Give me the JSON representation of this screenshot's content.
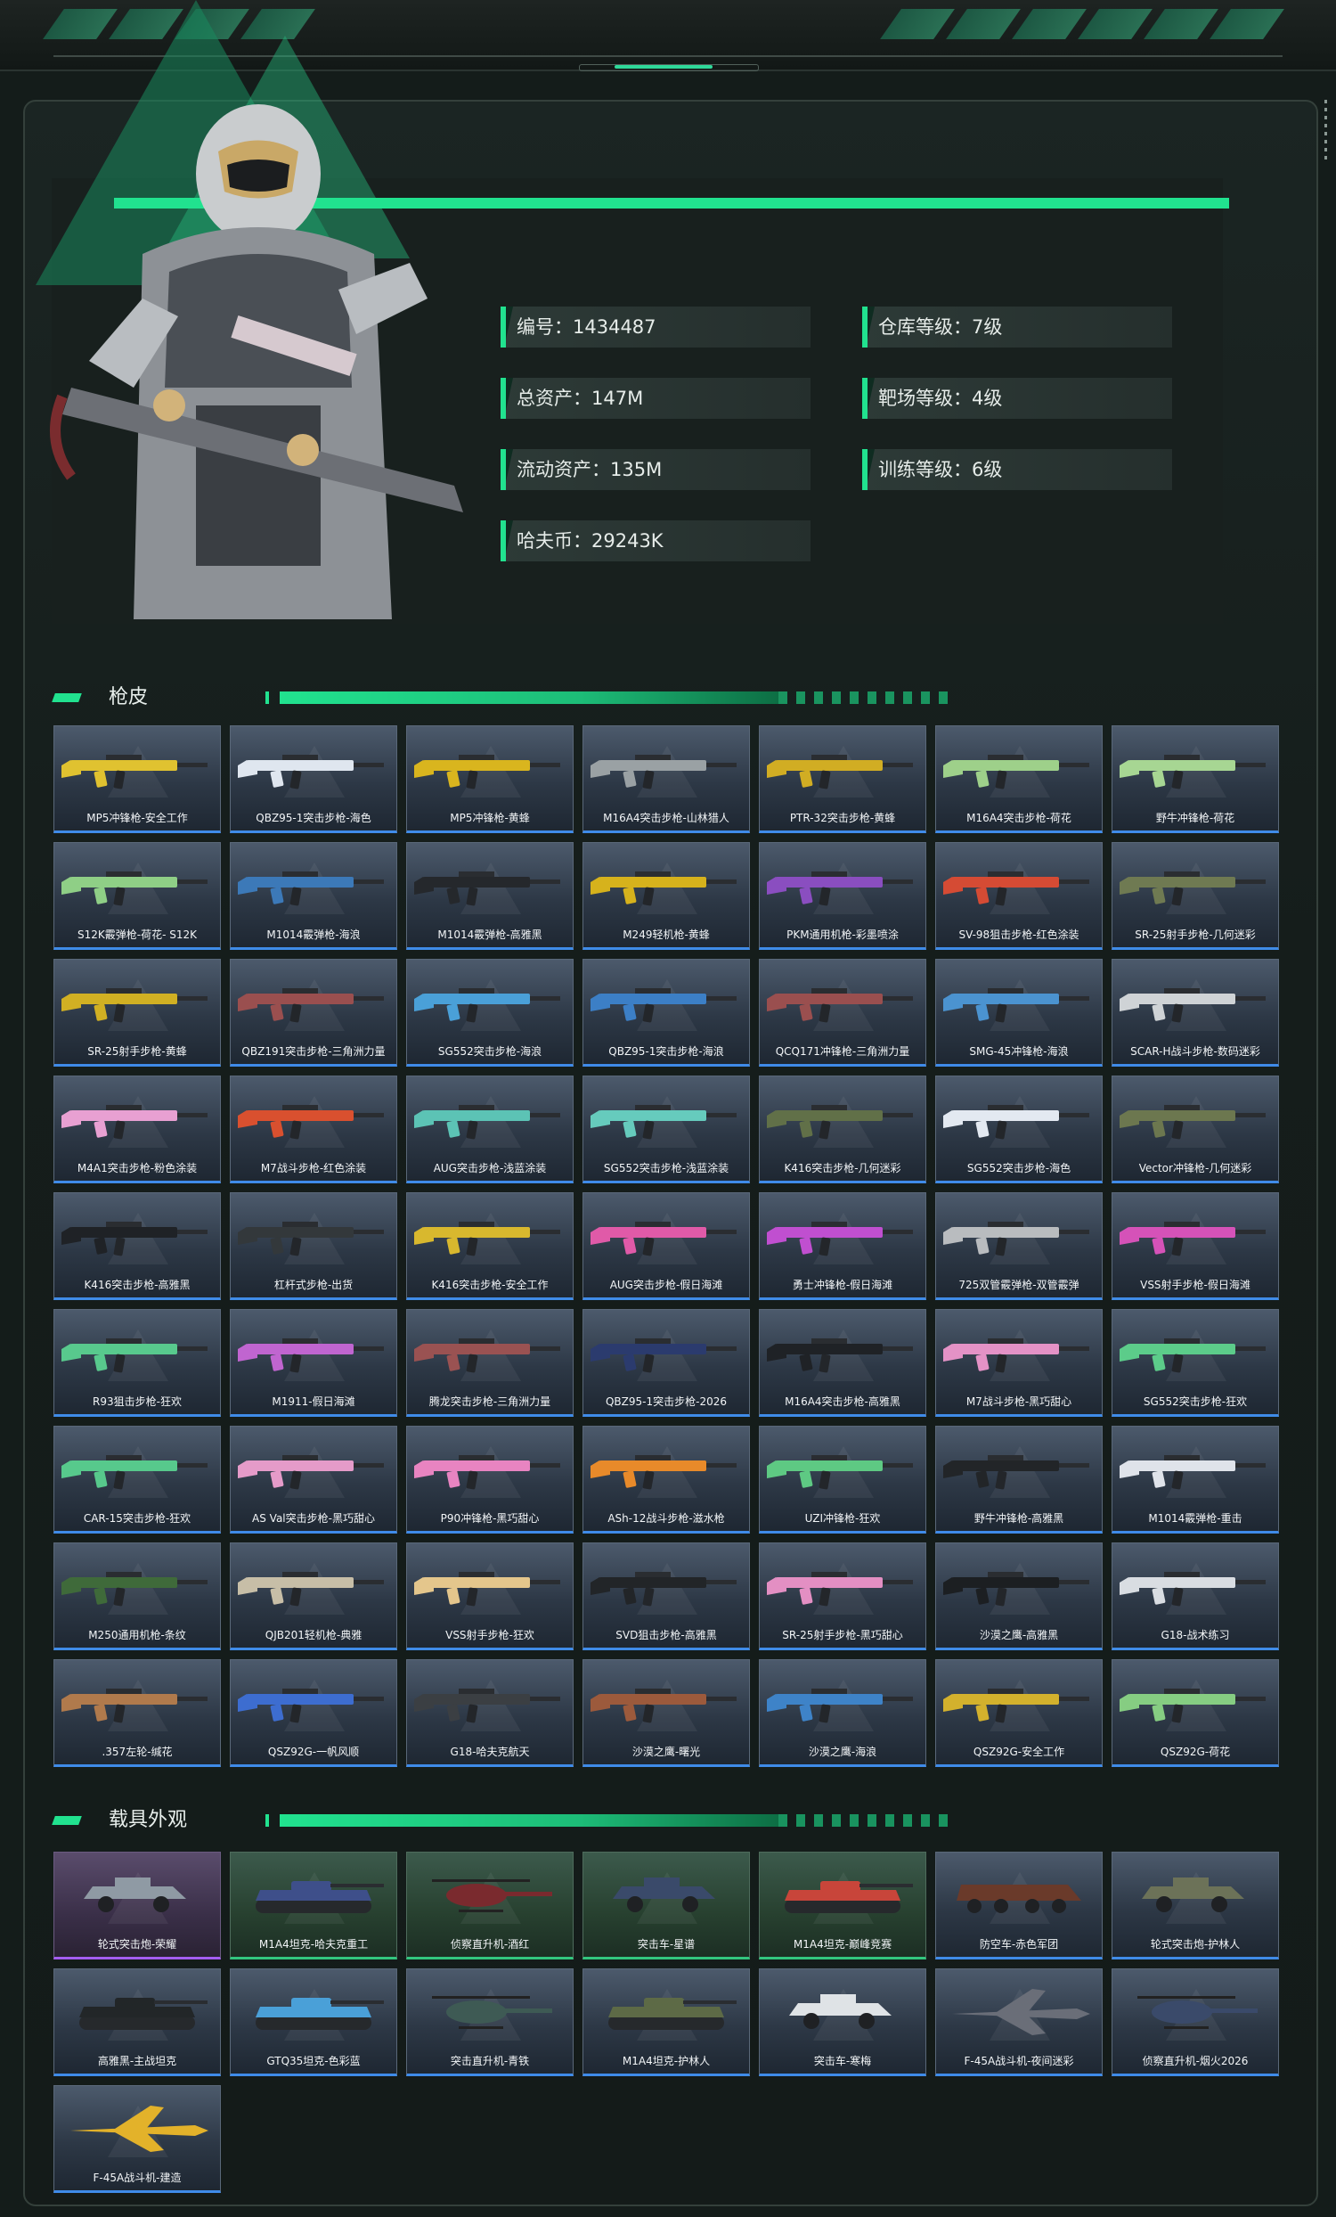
{
  "colors": {
    "accent": "#21e28f",
    "card_blue": "#3f8be8",
    "card_green": "#32c57f",
    "card_purple": "#a45df2",
    "background": "#141c1a"
  },
  "profile": {
    "stats_left": [
      {
        "label": "编号：1434487"
      },
      {
        "label": "总资产：147M"
      },
      {
        "label": "流动资产：135M"
      },
      {
        "label": "哈夫币：29243K"
      }
    ],
    "stats_right": [
      {
        "label": "仓库等级：7级"
      },
      {
        "label": "靶场等级：4级"
      },
      {
        "label": "训练等级：6级"
      }
    ]
  },
  "sections": {
    "skins_title": "枪皮",
    "vehicles_title": "载具外观"
  },
  "skins": [
    {
      "name": "MP5冲锋枪-安全工作",
      "color": "#e0c230"
    },
    {
      "name": "QBZ95-1突击步枪-海色",
      "color": "#dfe6ef"
    },
    {
      "name": "MP5冲锋枪-黄蜂",
      "color": "#d9b51e"
    },
    {
      "name": "M16A4突击步枪-山林猎人",
      "color": "#9aa1a4"
    },
    {
      "name": "PTR-32突击步枪-黄蜂",
      "color": "#d1ad23"
    },
    {
      "name": "M16A4突击步枪-荷花",
      "color": "#9ed08a"
    },
    {
      "name": "野牛冲锋枪-荷花",
      "color": "#a7d693"
    },
    {
      "name": "S12K霰弹枪-荷花- S12K",
      "color": "#8fcf86"
    },
    {
      "name": "M1014霰弹枪-海浪",
      "color": "#3c79b8"
    },
    {
      "name": "M1014霰弹枪-高雅黑",
      "color": "#25282c"
    },
    {
      "name": "M249轻机枪-黄蜂",
      "color": "#d6b21c"
    },
    {
      "name": "PKM通用机枪-彩墨喷涂",
      "color": "#8a4ec0"
    },
    {
      "name": "SV-98狙击步枪-红色涂装",
      "color": "#d54b34"
    },
    {
      "name": "SR-25射手步枪-几何迷彩",
      "color": "#6f7a52"
    },
    {
      "name": "SR-25射手步枪-黄蜂",
      "color": "#d1b023"
    },
    {
      "name": "QBZ191突击步枪-三角洲力量",
      "color": "#9a4f4f"
    },
    {
      "name": "SG552突击步枪-海浪",
      "color": "#4aa0d8"
    },
    {
      "name": "QBZ95-1突击步枪-海浪",
      "color": "#3c7fc6"
    },
    {
      "name": "QCQ171冲锋枪-三角洲力量",
      "color": "#9a4f4f"
    },
    {
      "name": "SMG-45冲锋枪-海浪",
      "color": "#4b93d0"
    },
    {
      "name": "SCAR-H战斗步枪-数码迷彩",
      "color": "#cfd3d6"
    },
    {
      "name": "M4A1突击步枪-粉色涂装",
      "color": "#e8a0d2"
    },
    {
      "name": "M7战斗步枪-红色涂装",
      "color": "#d9502f"
    },
    {
      "name": "AUG突击步枪-浅蓝涂装",
      "color": "#5cc3b5"
    },
    {
      "name": "SG552突击步枪-浅蓝涂装",
      "color": "#66cbbd"
    },
    {
      "name": "K416突击步枪-几何迷彩",
      "color": "#617048"
    },
    {
      "name": "SG552突击步枪-海色",
      "color": "#e3e9f1"
    },
    {
      "name": "Vector冲锋枪-几何迷彩",
      "color": "#6c774f"
    },
    {
      "name": "K416突击步枪-高雅黑",
      "color": "#1f2226"
    },
    {
      "name": "杠杆式步枪-出货",
      "color": "#33383b"
    },
    {
      "name": "K416突击步枪-安全工作",
      "color": "#d8b82e"
    },
    {
      "name": "AUG突击步枪-假日海滩",
      "color": "#e05aa8"
    },
    {
      "name": "勇士冲锋枪-假日海滩",
      "color": "#c04fd0"
    },
    {
      "name": "725双管霰弹枪-双管霰弹",
      "color": "#b9bcbf"
    },
    {
      "name": "VSS射手步枪-假日海滩",
      "color": "#d552b8"
    },
    {
      "name": "R93狙击步枪-狂欢",
      "color": "#58c98d"
    },
    {
      "name": "M1911-假日海滩",
      "color": "#c065d0"
    },
    {
      "name": "腾龙突击步枪-三角洲力量",
      "color": "#9a5252"
    },
    {
      "name": "QBZ95-1突击步枪-2026",
      "color": "#2b3b6e"
    },
    {
      "name": "M16A4突击步枪-高雅黑",
      "color": "#1f2226"
    },
    {
      "name": "M7战斗步枪-黑巧甜心",
      "color": "#e492c6"
    },
    {
      "name": "SG552突击步枪-狂欢",
      "color": "#5ccc8a"
    },
    {
      "name": "CAR-15突击步枪-狂欢",
      "color": "#57c98c"
    },
    {
      "name": "AS Val突击步枪-黑巧甜心",
      "color": "#e59bc9"
    },
    {
      "name": "P90冲锋枪-黑巧甜心",
      "color": "#e884c1"
    },
    {
      "name": "ASh-12战斗步枪-滋水枪",
      "color": "#e88a2a"
    },
    {
      "name": "UZI冲锋枪-狂欢",
      "color": "#5ec983"
    },
    {
      "name": "野牛冲锋枪-高雅黑",
      "color": "#222528"
    },
    {
      "name": "M1014霰弹枪-重击",
      "color": "#dfe3ea"
    },
    {
      "name": "M250通用机枪-条纹",
      "color": "#3f6a3a"
    },
    {
      "name": "QJB201轻机枪-典雅",
      "color": "#c7bea7"
    },
    {
      "name": "VSS射手步枪-狂欢",
      "color": "#e4c68c"
    },
    {
      "name": "SVD狙击步枪-高雅黑",
      "color": "#222528"
    },
    {
      "name": "SR-25射手步枪-黑巧甜心",
      "color": "#e38fc3"
    },
    {
      "name": "沙漠之鹰-高雅黑",
      "color": "#1c1f22"
    },
    {
      "name": "G18-战术练习",
      "color": "#d9dde2"
    },
    {
      "name": ".357左轮-缄花",
      "color": "#b07a4c"
    },
    {
      "name": "QSZ92G-一帆风顺",
      "color": "#3d6dd0"
    },
    {
      "name": "G18-哈夫克航天",
      "color": "#3b3f43"
    },
    {
      "name": "沙漠之鹰-曙光",
      "color": "#9c5a3c"
    },
    {
      "name": "沙漠之鹰-海浪",
      "color": "#3e83c8"
    },
    {
      "name": "QSZ92G-安全工作",
      "color": "#d3b12d"
    },
    {
      "name": "QSZ92G-荷花",
      "color": "#86cd82"
    }
  ],
  "vehicles": [
    {
      "name": "轮式突击炮-荣耀",
      "color": "#8f9aa4",
      "tier": "purple",
      "kind": "car"
    },
    {
      "name": "M1A4坦克-哈夫克重工",
      "color": "#3e4f8a",
      "tier": "green",
      "kind": "tank"
    },
    {
      "name": "侦察直升机-酒红",
      "color": "#7a2a2e",
      "tier": "green",
      "kind": "heli"
    },
    {
      "name": "突击车-星谱",
      "color": "#3a4a6a",
      "tier": "green",
      "kind": "car"
    },
    {
      "name": "M1A4坦克-巅峰竞赛",
      "color": "#c8453a",
      "tier": "green",
      "kind": "tank"
    },
    {
      "name": "防空车-赤色军团",
      "color": "#6a3a2a",
      "tier": "blue",
      "kind": "apc"
    },
    {
      "name": "轮式突击炮-护林人",
      "color": "#6c7258",
      "tier": "blue",
      "kind": "car"
    },
    {
      "name": "高雅黑-主战坦克",
      "color": "#222628",
      "tier": "blue",
      "kind": "tank"
    },
    {
      "name": "GTQ35坦克-色彩蓝",
      "color": "#4aa0d8",
      "tier": "blue",
      "kind": "tank"
    },
    {
      "name": "突击直升机-青铁",
      "color": "#3e5a54",
      "tier": "blue",
      "kind": "heli"
    },
    {
      "name": "M1A4坦克-护林人",
      "color": "#5d6a46",
      "tier": "blue",
      "kind": "tank"
    },
    {
      "name": "突击车-寒梅",
      "color": "#dfe3e6",
      "tier": "blue",
      "kind": "car"
    },
    {
      "name": "F-45A战斗机-夜间迷彩",
      "color": "#6a6e78",
      "tier": "blue",
      "kind": "jet"
    },
    {
      "name": "侦察直升机-烟火2026",
      "color": "#3a4a6a",
      "tier": "blue",
      "kind": "heli"
    },
    {
      "name": "F-45A战斗机-建造",
      "color": "#e3b22a",
      "tier": "blue",
      "kind": "jet"
    }
  ]
}
